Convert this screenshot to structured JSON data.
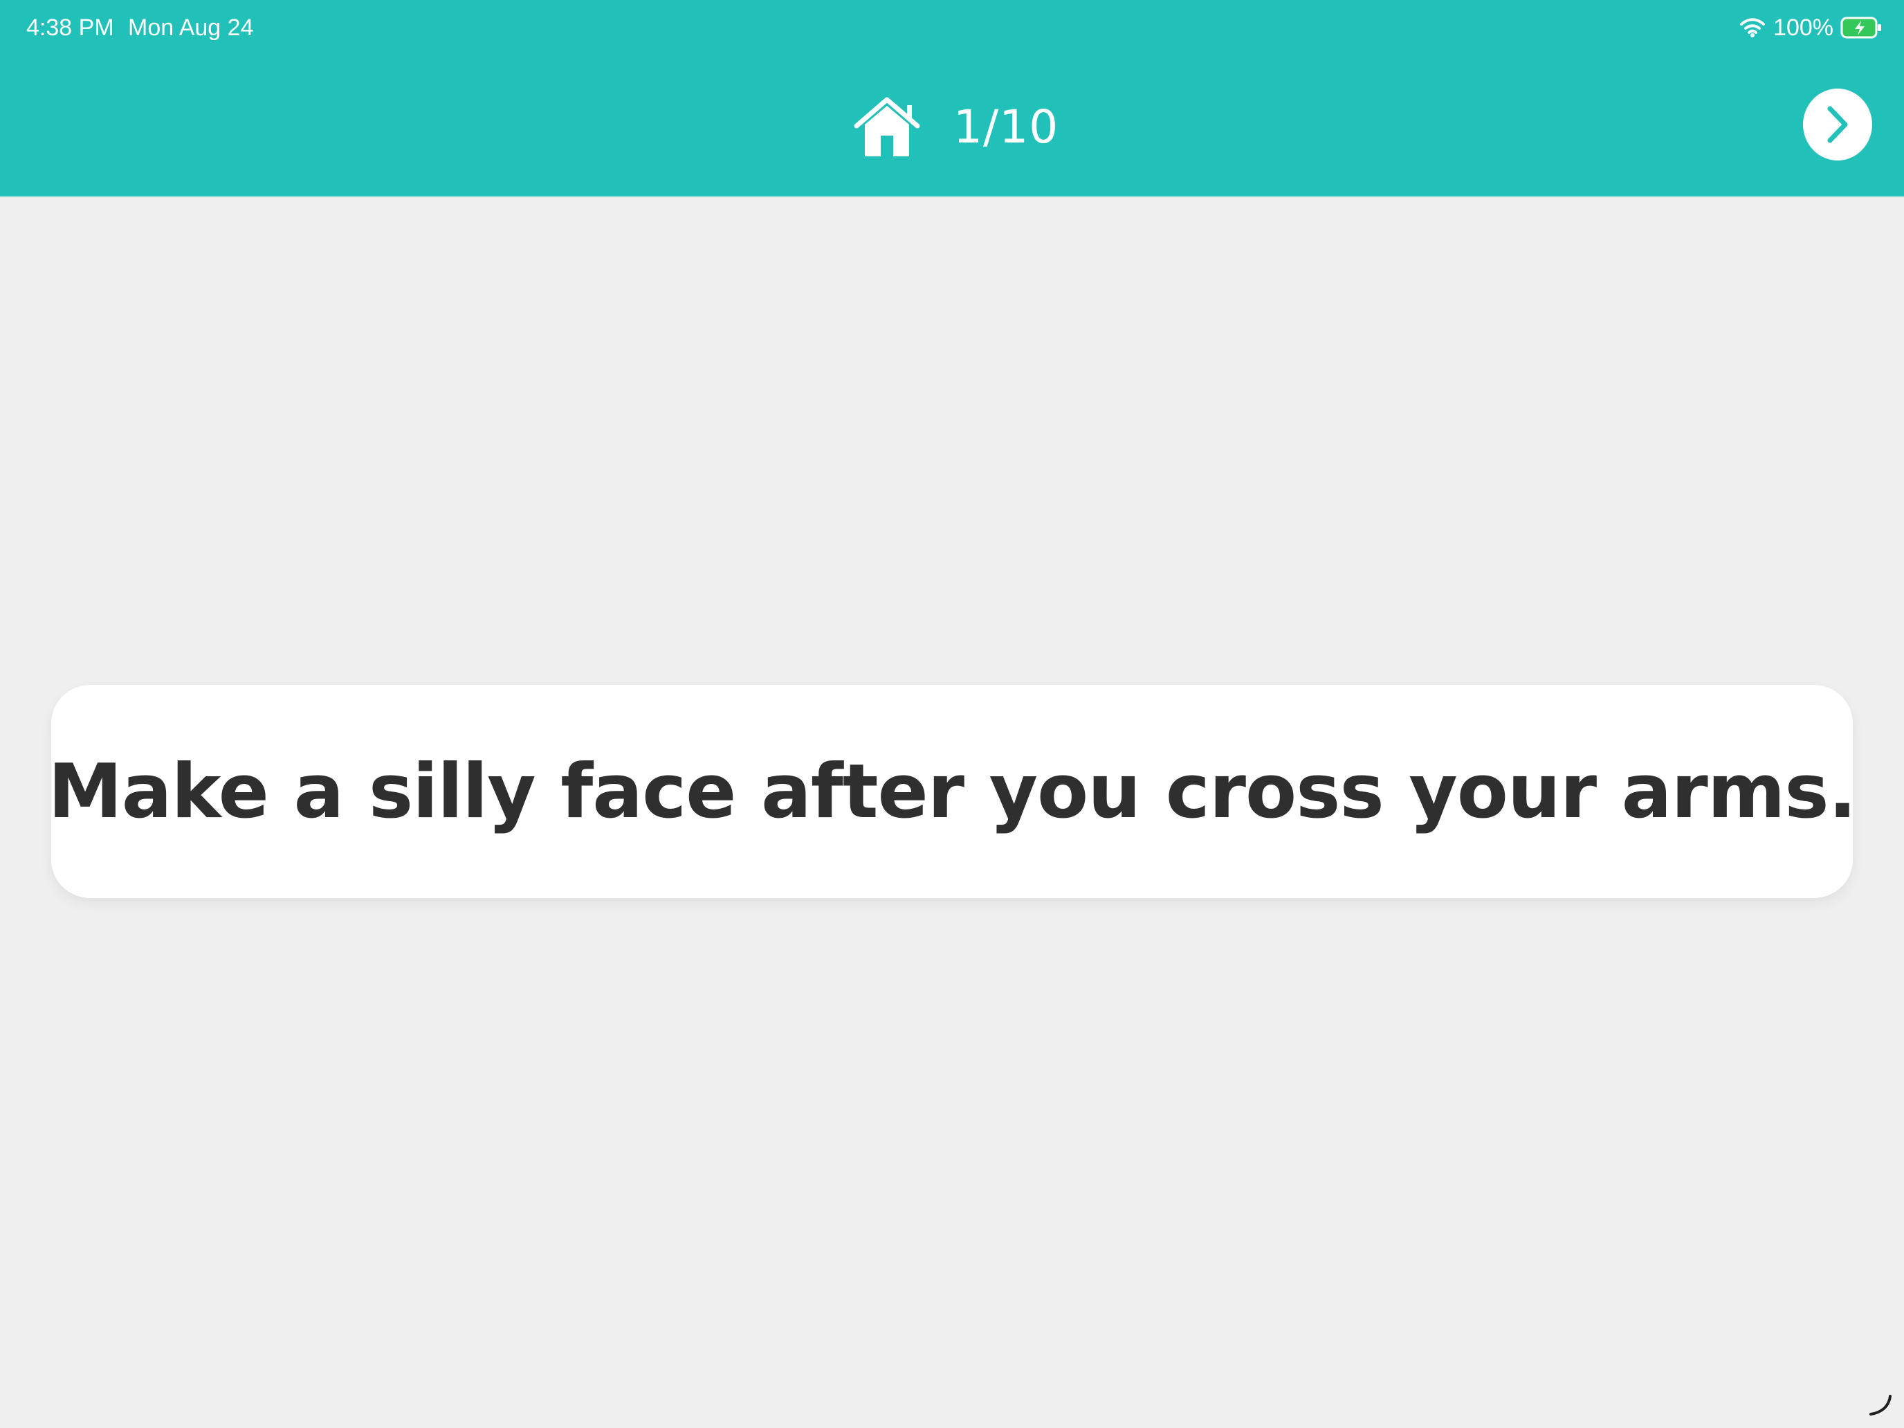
{
  "status_bar": {
    "time": "4:38 PM",
    "date": "Mon Aug 24",
    "battery_percent": "100%",
    "wifi_icon": "wifi-icon",
    "battery_icon": "battery-charging-icon"
  },
  "header": {
    "home_icon": "home-icon",
    "progress": "1/10",
    "next_icon": "chevron-right-icon"
  },
  "card": {
    "text": "Make a silly face after you cross your arms."
  },
  "colors": {
    "header_bg": "#21c0b9",
    "page_bg": "#efefef",
    "card_bg": "#ffffff",
    "text": "#2f2f2f",
    "battery_green": "#34c759"
  }
}
